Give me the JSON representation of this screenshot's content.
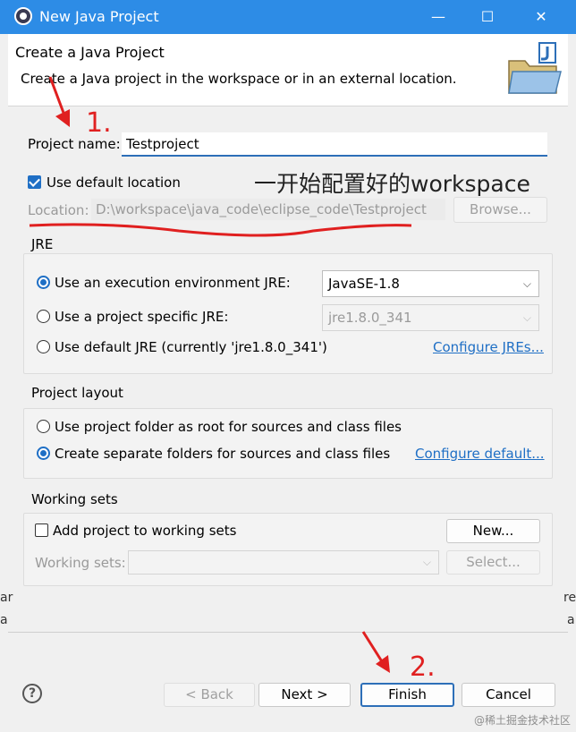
{
  "window": {
    "title": "New Java Project",
    "minimize": "—",
    "maximize": "☐",
    "close": "✕"
  },
  "header": {
    "title": "Create a Java Project",
    "description": "Create a Java project in the workspace or in an external location."
  },
  "project": {
    "name_label": "Project name:",
    "name_value": "Testproject",
    "use_default_location_label": "Use default location",
    "use_default_location_checked": true,
    "location_label": "Location:",
    "location_value": "D:\\workspace\\java_code\\eclipse_code\\Testproject",
    "browse_label": "Browse..."
  },
  "jre": {
    "group_title": "JRE",
    "options": [
      {
        "label": "Use an execution environment JRE:",
        "selected": true
      },
      {
        "label": "Use a project specific JRE:",
        "selected": false
      },
      {
        "label": "Use default JRE (currently 'jre1.8.0_341')",
        "selected": false
      }
    ],
    "env_select_value": "JavaSE-1.8",
    "specific_select_value": "jre1.8.0_341",
    "configure_link": "Configure JREs..."
  },
  "layout": {
    "group_title": "Project layout",
    "options": [
      {
        "label": "Use project folder as root for sources and class files",
        "selected": false
      },
      {
        "label": "Create separate folders for sources and class files",
        "selected": true
      }
    ],
    "configure_link": "Configure default..."
  },
  "working_sets": {
    "group_title": "Working sets",
    "add_label": "Add project to working sets",
    "add_checked": false,
    "new_button": "New...",
    "sets_label": "Working sets:",
    "select_button": "Select..."
  },
  "footer": {
    "help": "?",
    "back": "< Back",
    "next": "Next >",
    "finish": "Finish",
    "cancel": "Cancel"
  },
  "annotations": {
    "step1": "1.",
    "step2": "2.",
    "note": "一开始配置好的workspace",
    "color": "#e02020"
  },
  "side_fragments": {
    "left_a": "ar",
    "left_b": "a",
    "right_a": "re",
    "right_b": "a"
  },
  "watermark": "@稀土掘金技术社区"
}
